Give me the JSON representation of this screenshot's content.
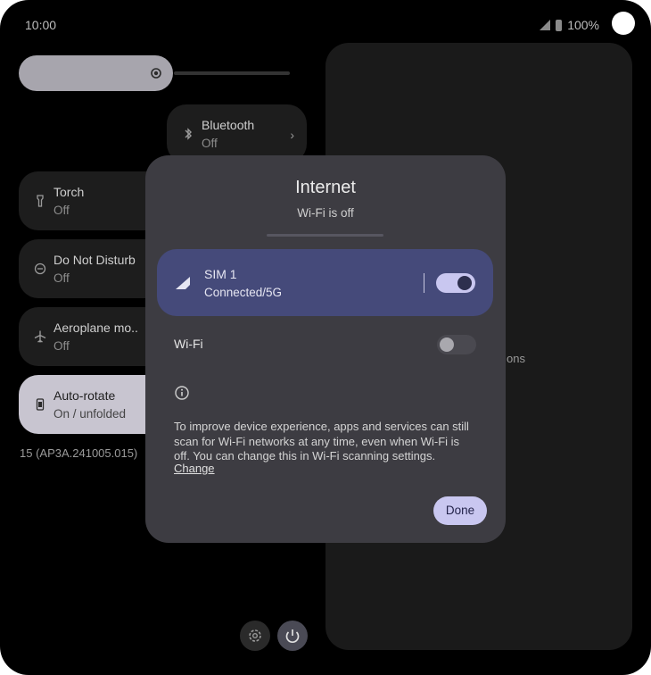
{
  "status_bar": {
    "time": "10:00",
    "battery": "100%"
  },
  "brightness": {
    "icon": "brightness-icon",
    "level": 0.45
  },
  "tiles": [
    {
      "title": "Bluetooth",
      "state": "Off",
      "icon": "bluetooth-icon"
    },
    {
      "title": "Torch",
      "state": "Off",
      "icon": "torch-icon"
    },
    {
      "title": "Do Not Disturb",
      "state": "Off",
      "icon": "do-not-disturb-icon"
    },
    {
      "title": "Aeroplane mo..",
      "state": "Off",
      "icon": "airplane-icon"
    },
    {
      "title": "Auto-rotate",
      "state": "On / unfolded",
      "icon": "rotate-icon"
    }
  ],
  "build_number": "15 (AP3A.241005.015)",
  "right_panel": {
    "partial_text": "ons"
  },
  "dialog": {
    "title": "Internet",
    "subtitle": "Wi-Fi is off",
    "sim": {
      "name": "SIM 1",
      "status": "Connected/5G",
      "enabled": true
    },
    "wifi": {
      "label": "Wi-Fi",
      "enabled": false
    },
    "info_text": "To improve device experience, apps and services can still scan for Wi-Fi networks at any time, even when Wi-Fi is off. You can change this in Wi-Fi scanning settings.",
    "change_link": "Change",
    "done_label": "Done"
  },
  "colors": {
    "accent": "#c9c7f0",
    "sim_card": "#454a7a",
    "dialog_bg": "#3d3c42"
  }
}
